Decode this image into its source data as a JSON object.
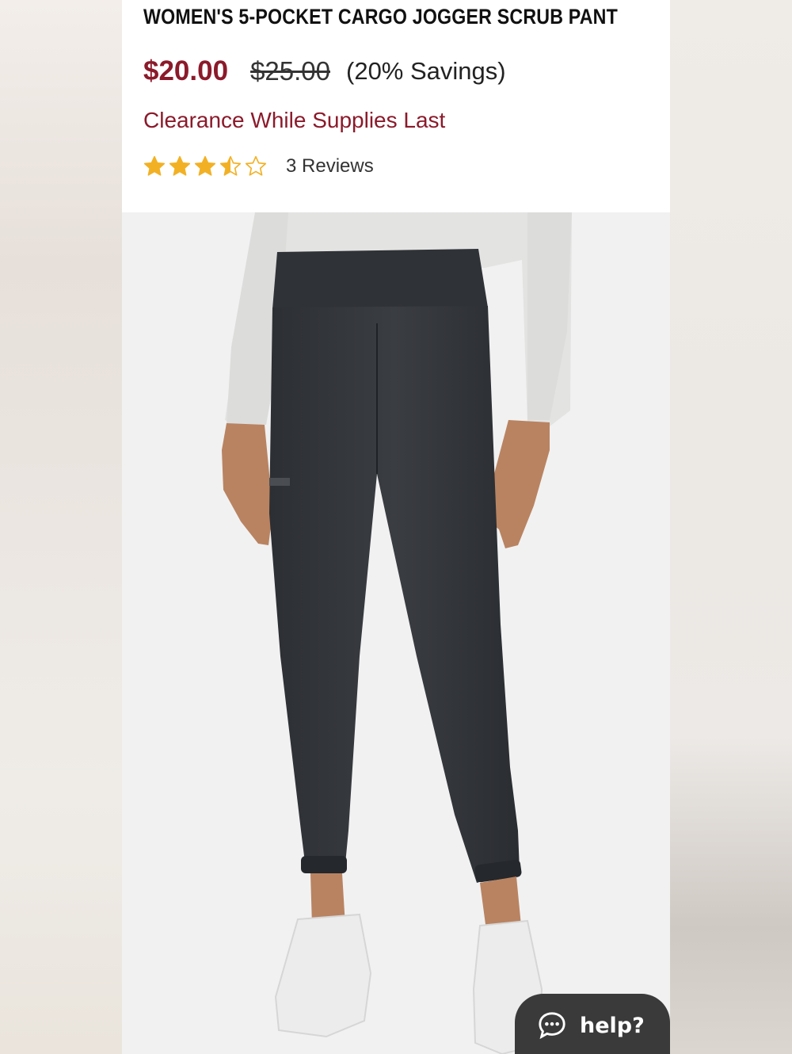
{
  "product": {
    "title": "WOMEN'S 5-POCKET CARGO JOGGER SCRUB PANT",
    "price_current": "$20.00",
    "price_original": "$25.00",
    "savings": "(20% Savings)",
    "clearance": "Clearance While Supplies Last",
    "rating": 3.5,
    "rating_max": 5,
    "reviews_label": "3 Reviews",
    "image_icon": "product-photo-jogger-pant"
  },
  "help_widget": {
    "label": "help?",
    "icon": "chat-bubble-icon"
  },
  "colors": {
    "brand_red": "#8b1a2b",
    "star_gold": "#f2b124",
    "widget_bg": "#3a3a3a"
  }
}
